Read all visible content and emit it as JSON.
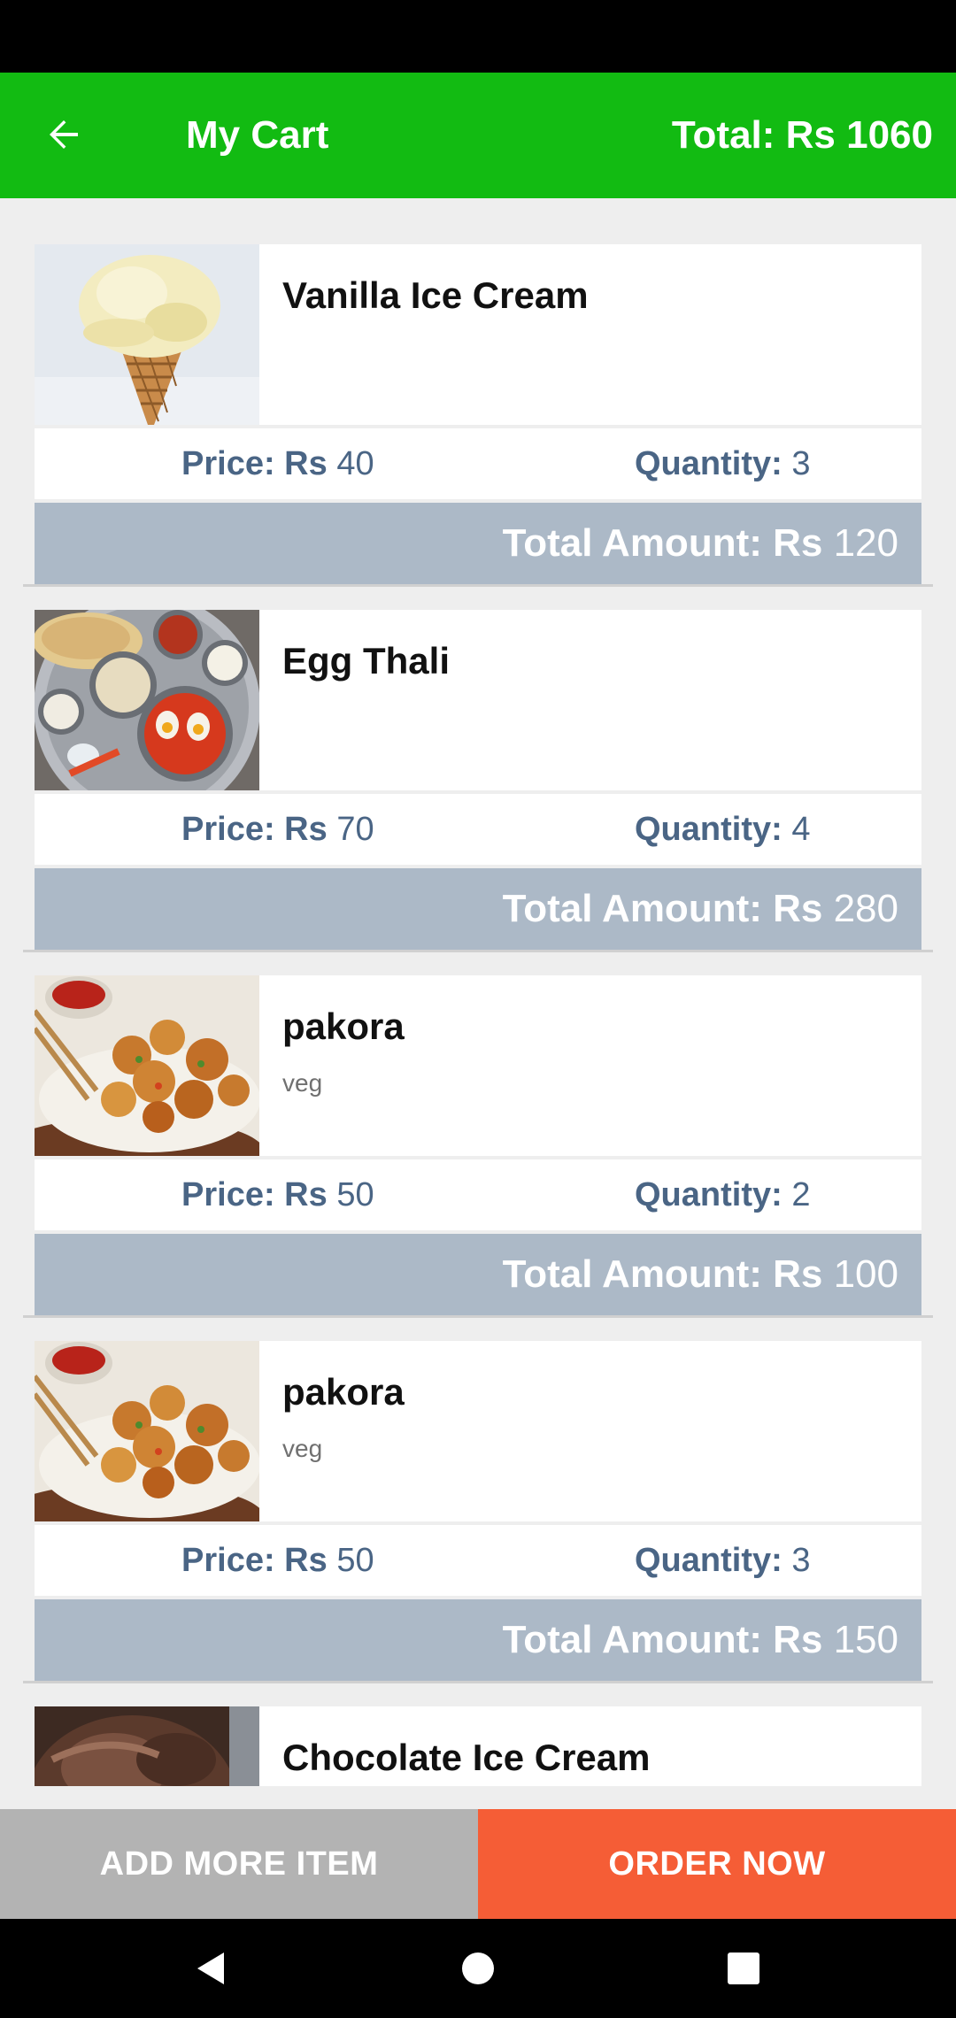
{
  "app_bar": {
    "title": "My Cart",
    "total": "Total: Rs 1060"
  },
  "cart": {
    "items": [
      {
        "name": "Vanilla Ice Cream",
        "desc": "",
        "price_label": "Price: Rs",
        "price": "40",
        "qty_label": "Quantity:",
        "qty": "3",
        "total_label": "Total Amount: Rs",
        "total": "120",
        "image": "vanilla-ice-cream"
      },
      {
        "name": "Egg Thali",
        "desc": "",
        "price_label": "Price: Rs",
        "price": "70",
        "qty_label": "Quantity:",
        "qty": "4",
        "total_label": "Total Amount: Rs",
        "total": "280",
        "image": "egg-thali"
      },
      {
        "name": "pakora",
        "desc": "veg",
        "price_label": "Price: Rs",
        "price": "50",
        "qty_label": "Quantity:",
        "qty": "2",
        "total_label": "Total Amount: Rs",
        "total": "100",
        "image": "pakora"
      },
      {
        "name": "pakora",
        "desc": "veg",
        "price_label": "Price: Rs",
        "price": "50",
        "qty_label": "Quantity:",
        "qty": "3",
        "total_label": "Total Amount: Rs",
        "total": "150",
        "image": "pakora"
      },
      {
        "name": "Chocolate Ice Cream",
        "desc": "",
        "image": "chocolate-ice-cream"
      }
    ]
  },
  "actions": {
    "add_more": "ADD MORE ITEM",
    "order_now": "ORDER NOW"
  },
  "colors": {
    "app_bar": "#12bb12",
    "total_row": "#acb9c7",
    "order_button": "#f55d36",
    "add_button": "#b3b3b3",
    "price_text": "#4a6585"
  }
}
